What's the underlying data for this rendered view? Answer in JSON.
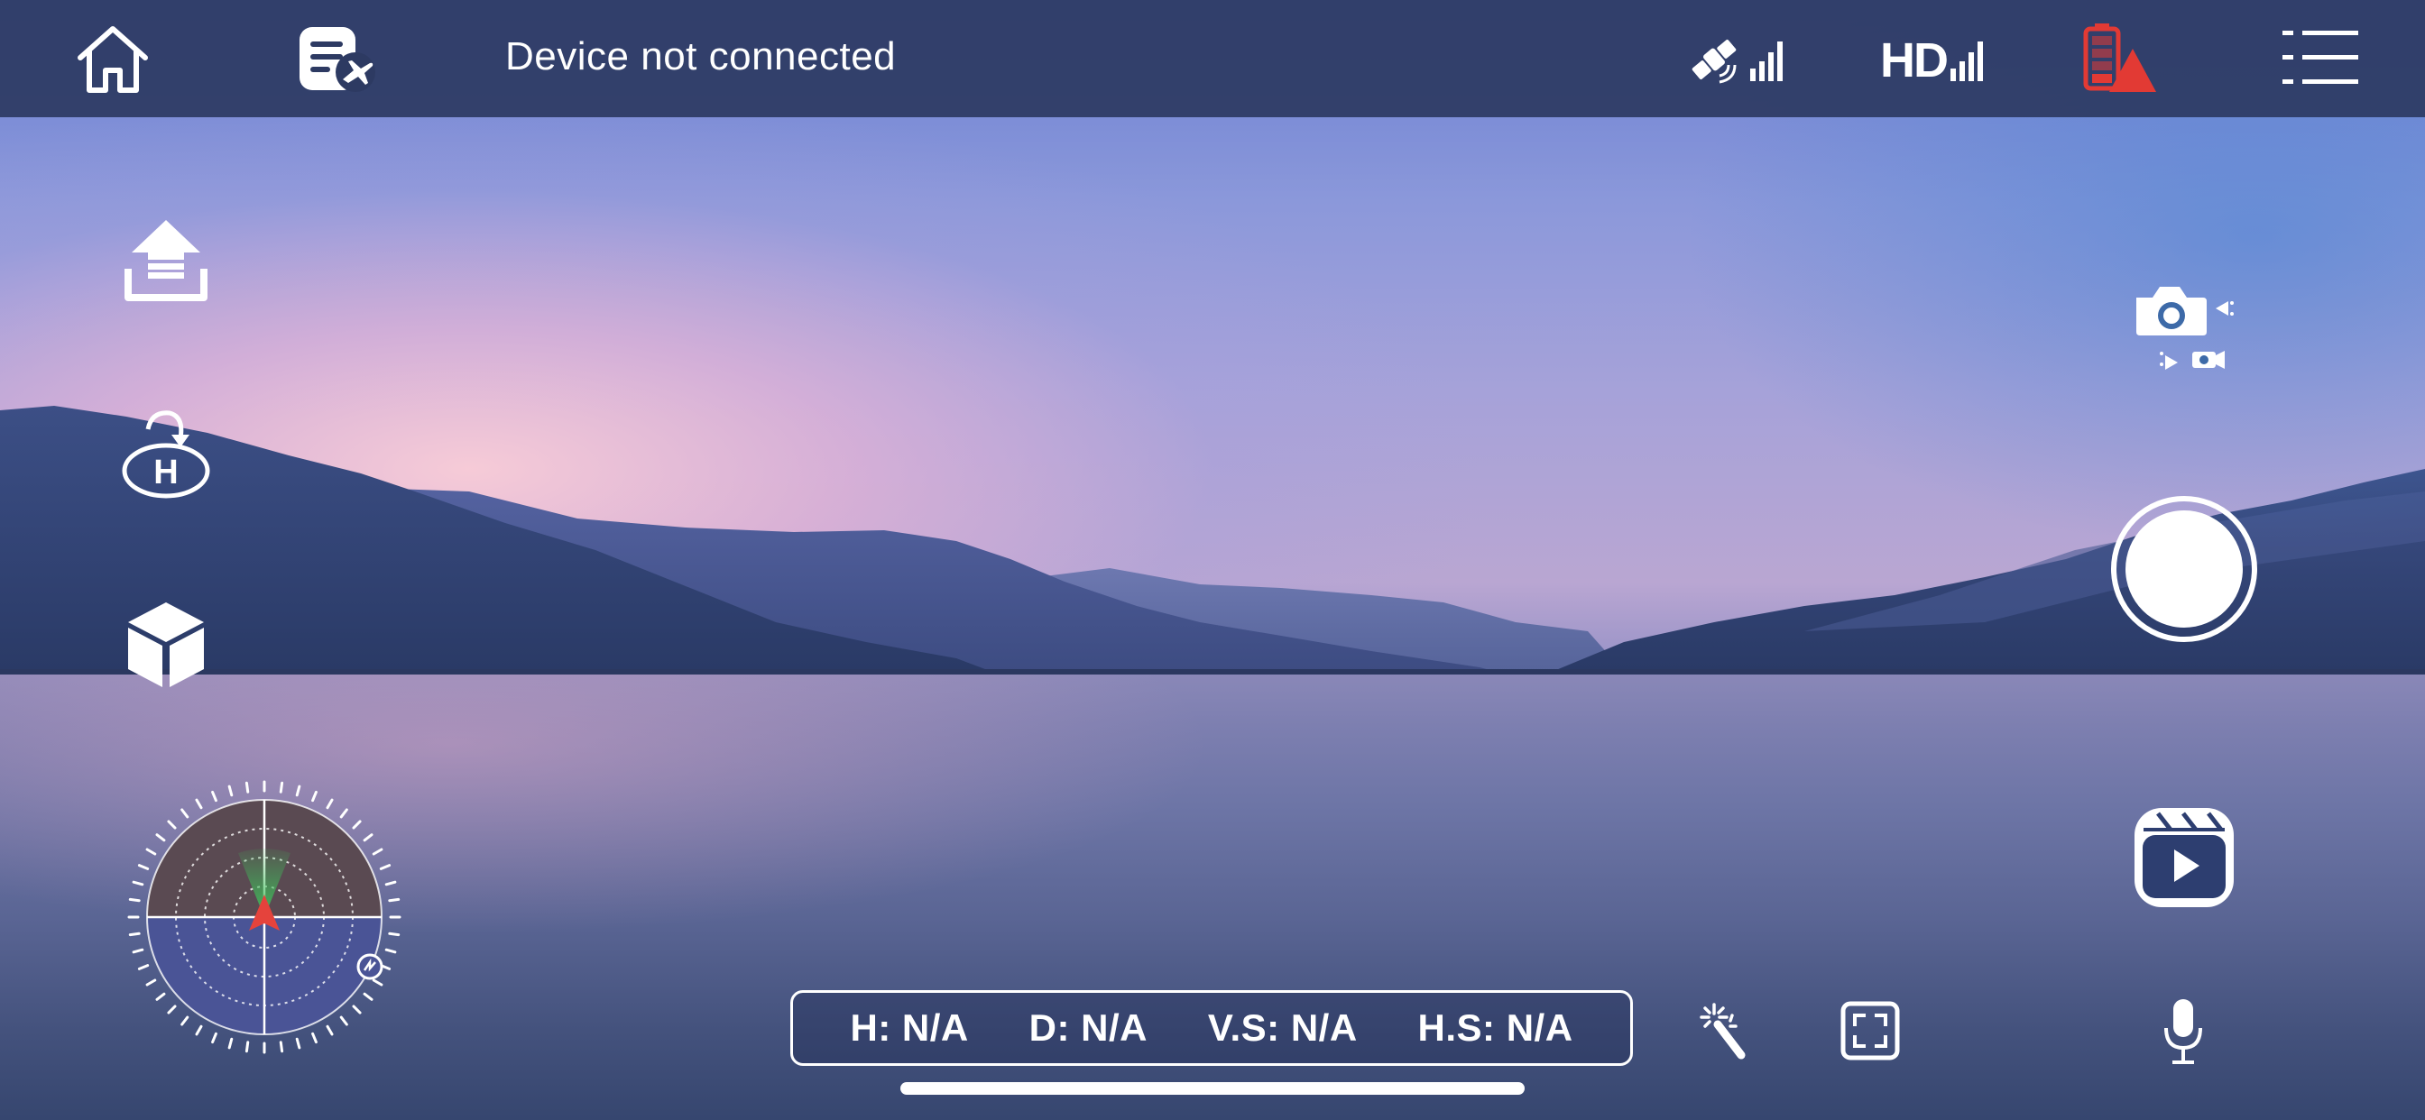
{
  "topbar": {
    "status": "Device not connected",
    "video_link_label": "HD",
    "icons": {
      "home": "home-icon",
      "flight_log": "flight-log-icon",
      "gps_signal": "satellite-signal-icon",
      "video_signal": "hd-signal-icon",
      "battery": "battery-warning-icon",
      "menu": "menu-icon"
    }
  },
  "left_controls": [
    "takeoff-icon",
    "return-home-icon",
    "3d-cube-icon"
  ],
  "right_controls": [
    "camera-mode-switch-icon",
    "shutter-button",
    "media-library-icon"
  ],
  "telemetry": {
    "height": "H: N/A",
    "distance": "D: N/A",
    "vertical_speed": "V.S: N/A",
    "horizontal_speed": "H.S: N/A"
  },
  "bottom_tools": [
    "magic-wand-icon",
    "fullscreen-focus-icon",
    "microphone-icon"
  ],
  "colors": {
    "topbar_bg": "#2d3a62",
    "radar_top": "#5a4a52",
    "radar_bottom": "#4a5496",
    "heading_arrow": "#e5433c",
    "heading_cone": "#3fbf5a",
    "battery_warning": "#e23a34"
  }
}
